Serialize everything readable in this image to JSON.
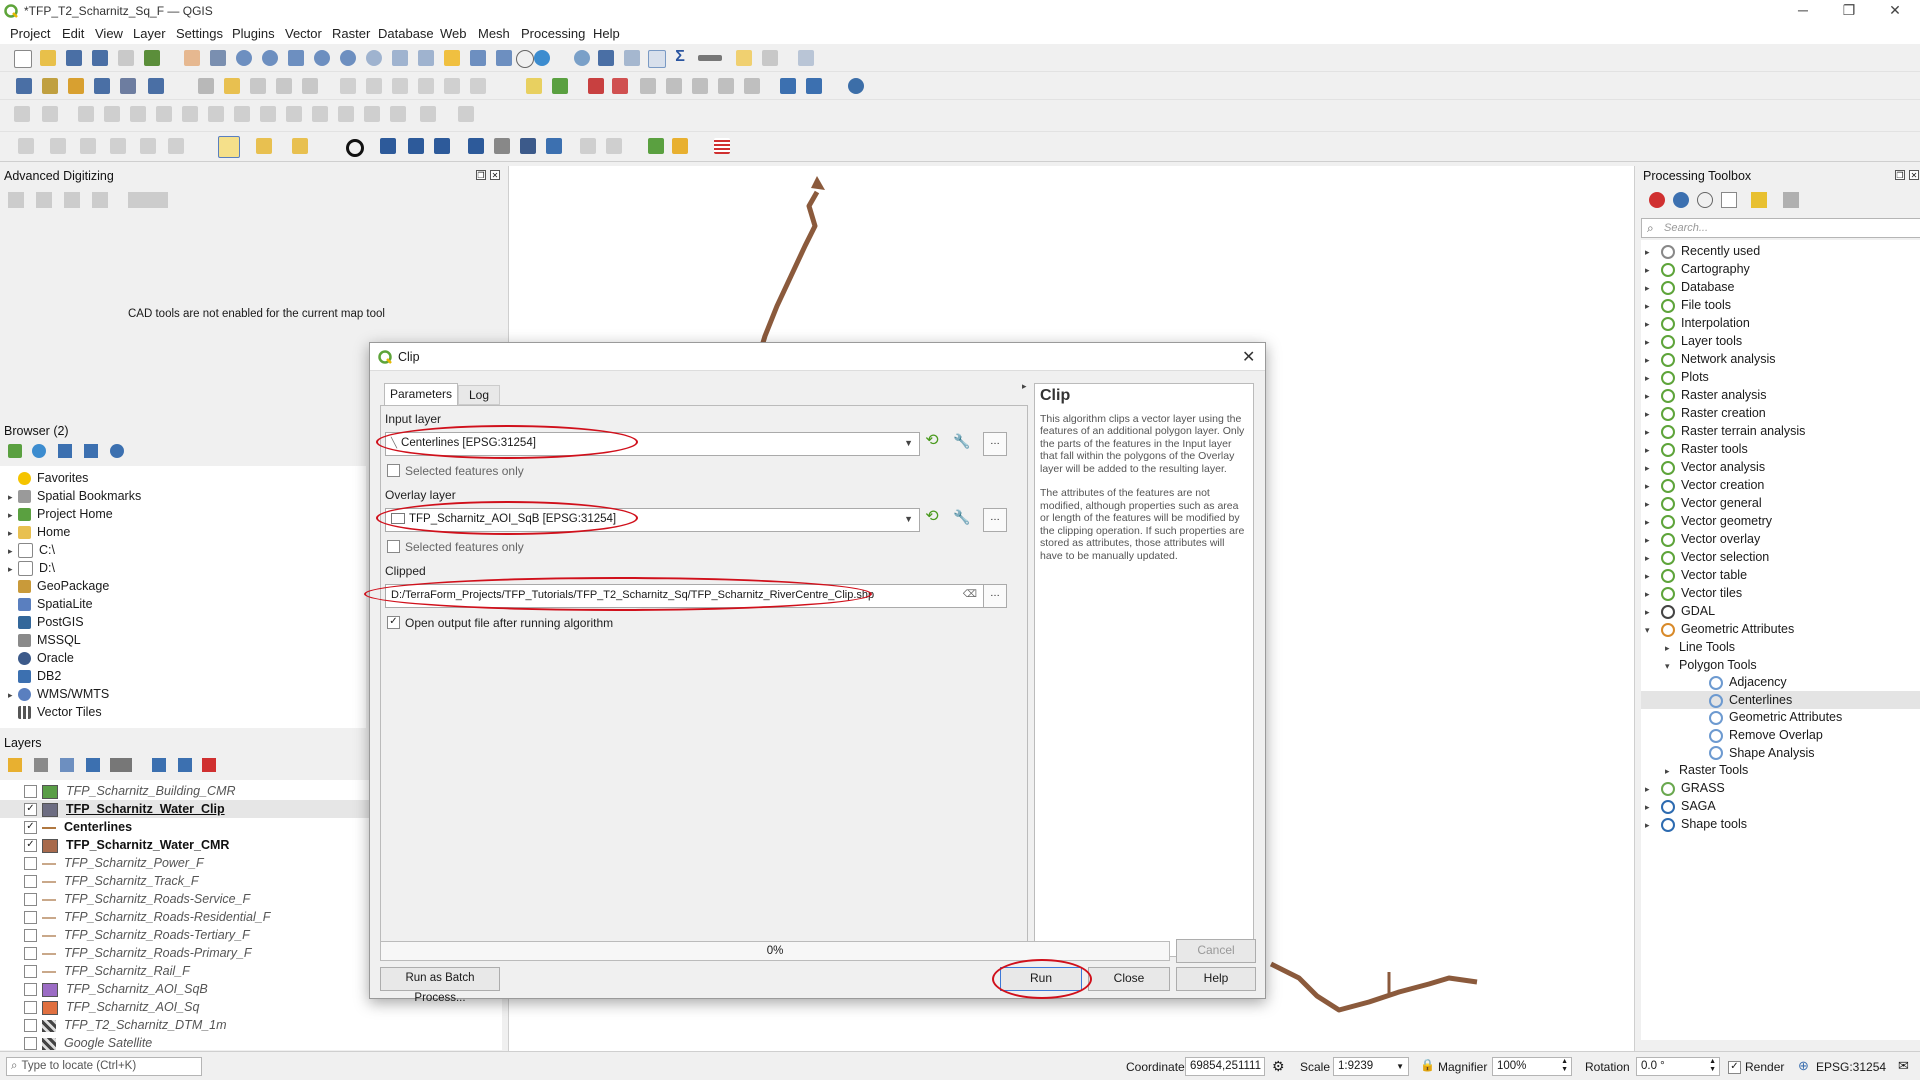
{
  "window": {
    "title": "*TFP_T2_Scharnitz_Sq_F — QGIS"
  },
  "menu": [
    "Project",
    "Edit",
    "View",
    "Layer",
    "Settings",
    "Plugins",
    "Vector",
    "Raster",
    "Database",
    "Web",
    "Mesh",
    "Processing",
    "Help"
  ],
  "adv_digitizing": {
    "title": "Advanced Digitizing",
    "message": "CAD tools are not enabled for the current map tool"
  },
  "browser": {
    "title": "Browser (2)",
    "items": [
      {
        "label": "Favorites",
        "icon": "star-icon",
        "expandable": false
      },
      {
        "label": "Spatial Bookmarks",
        "icon": "bookmark-icon",
        "expandable": true
      },
      {
        "label": "Project Home",
        "icon": "folder-icon",
        "expandable": true
      },
      {
        "label": "Home",
        "icon": "folder-icon",
        "expandable": true
      },
      {
        "label": "C:\\",
        "icon": "drive-icon",
        "expandable": true
      },
      {
        "label": "D:\\",
        "icon": "drive-icon",
        "expandable": true
      },
      {
        "label": "GeoPackage",
        "icon": "geopackage-icon",
        "expandable": false
      },
      {
        "label": "SpatiaLite",
        "icon": "spatialite-icon",
        "expandable": false
      },
      {
        "label": "PostGIS",
        "icon": "postgis-icon",
        "expandable": false
      },
      {
        "label": "MSSQL",
        "icon": "mssql-icon",
        "expandable": false
      },
      {
        "label": "Oracle",
        "icon": "oracle-icon",
        "expandable": false
      },
      {
        "label": "DB2",
        "icon": "db2-icon",
        "expandable": false
      },
      {
        "label": "WMS/WMTS",
        "icon": "globe-icon",
        "expandable": true
      },
      {
        "label": "Vector Tiles",
        "icon": "grid-icon",
        "expandable": false
      }
    ]
  },
  "layers": {
    "title": "Layers",
    "items": [
      {
        "label": "TFP_Scharnitz_Building_CMR",
        "checked": false,
        "swatch": "#5a9e47",
        "kind": "fill"
      },
      {
        "label": "TFP_Scharnitz_Water_Clip",
        "checked": true,
        "swatch": "#6d6d82",
        "kind": "fill",
        "underline": true
      },
      {
        "label": "Centerlines",
        "checked": true,
        "swatch": "#b07840",
        "kind": "line"
      },
      {
        "label": "TFP_Scharnitz_Water_CMR",
        "checked": true,
        "swatch": "#a86a4c",
        "kind": "fill"
      },
      {
        "label": "TFP_Scharnitz_Power_F",
        "checked": false,
        "swatch": "#c9a88a",
        "kind": "line"
      },
      {
        "label": "TFP_Scharnitz_Track_F",
        "checked": false,
        "swatch": "#c9a88a",
        "kind": "line"
      },
      {
        "label": "TFP_Scharnitz_Roads-Service_F",
        "checked": false,
        "swatch": "#c9a88a",
        "kind": "line"
      },
      {
        "label": "TFP_Scharnitz_Roads-Residential_F",
        "checked": false,
        "swatch": "#c9a88a",
        "kind": "line"
      },
      {
        "label": "TFP_Scharnitz_Roads-Tertiary_F",
        "checked": false,
        "swatch": "#c9a88a",
        "kind": "line"
      },
      {
        "label": "TFP_Scharnitz_Roads-Primary_F",
        "checked": false,
        "swatch": "#c9a88a",
        "kind": "line"
      },
      {
        "label": "TFP_Scharnitz_Rail_F",
        "checked": false,
        "swatch": "#c9a88a",
        "kind": "line"
      },
      {
        "label": "TFP_Scharnitz_AOI_SqB",
        "checked": false,
        "swatch": "#9b6cc4",
        "kind": "fill"
      },
      {
        "label": "TFP_Scharnitz_AOI_Sq",
        "checked": false,
        "swatch": "#e07040",
        "kind": "fill"
      },
      {
        "label": "TFP_T2_Scharnitz_DTM_1m",
        "checked": false,
        "swatch": "#888888",
        "kind": "raster"
      },
      {
        "label": "Google Satellite",
        "checked": false,
        "swatch": "#888888",
        "kind": "raster"
      }
    ]
  },
  "dialog": {
    "title": "Clip",
    "tabs": [
      "Parameters",
      "Log"
    ],
    "input_label": "Input layer",
    "input_value": "Centerlines [EPSG:31254]",
    "selected_only": "Selected features only",
    "overlay_label": "Overlay layer",
    "overlay_value": "TFP_Scharnitz_AOI_SqB [EPSG:31254]",
    "clipped_label": "Clipped",
    "clipped_value": "D:/TerraForm_Projects/TFP_Tutorials/TFP_T2_Scharnitz_Sq/TFP_Scharnitz_RiverCentre_Clip.shp",
    "open_output": "Open output file after running algorithm",
    "progress": "0%",
    "buttons": {
      "cancel": "Cancel",
      "batch": "Run as Batch Process...",
      "run": "Run",
      "close": "Close",
      "help": "Help"
    },
    "help_title": "Clip",
    "help_p1": "This algorithm clips a vector layer using the features of an additional polygon layer. Only the parts of the features in the Input layer that fall within the polygons of the Overlay layer will be added to the resulting layer.",
    "help_p2": "The attributes of the features are not modified, although properties such as area or length of the features will be modified by the clipping operation. If such properties are stored as attributes, those attributes will have to be manually updated."
  },
  "toolbox": {
    "title": "Processing Toolbox",
    "search_placeholder": "Search...",
    "items": [
      {
        "label": "Recently used",
        "level": 0,
        "arrow": "▸",
        "icon": "clock-icon"
      },
      {
        "label": "Cartography",
        "level": 0,
        "arrow": "▸",
        "icon": "qgis-icon"
      },
      {
        "label": "Database",
        "level": 0,
        "arrow": "▸",
        "icon": "qgis-icon"
      },
      {
        "label": "File tools",
        "level": 0,
        "arrow": "▸",
        "icon": "qgis-icon"
      },
      {
        "label": "Interpolation",
        "level": 0,
        "arrow": "▸",
        "icon": "qgis-icon"
      },
      {
        "label": "Layer tools",
        "level": 0,
        "arrow": "▸",
        "icon": "qgis-icon"
      },
      {
        "label": "Network analysis",
        "level": 0,
        "arrow": "▸",
        "icon": "qgis-icon"
      },
      {
        "label": "Plots",
        "level": 0,
        "arrow": "▸",
        "icon": "qgis-icon"
      },
      {
        "label": "Raster analysis",
        "level": 0,
        "arrow": "▸",
        "icon": "qgis-icon"
      },
      {
        "label": "Raster creation",
        "level": 0,
        "arrow": "▸",
        "icon": "qgis-icon"
      },
      {
        "label": "Raster terrain analysis",
        "level": 0,
        "arrow": "▸",
        "icon": "qgis-icon"
      },
      {
        "label": "Raster tools",
        "level": 0,
        "arrow": "▸",
        "icon": "qgis-icon"
      },
      {
        "label": "Vector analysis",
        "level": 0,
        "arrow": "▸",
        "icon": "qgis-icon"
      },
      {
        "label": "Vector creation",
        "level": 0,
        "arrow": "▸",
        "icon": "qgis-icon"
      },
      {
        "label": "Vector general",
        "level": 0,
        "arrow": "▸",
        "icon": "qgis-icon"
      },
      {
        "label": "Vector geometry",
        "level": 0,
        "arrow": "▸",
        "icon": "qgis-icon"
      },
      {
        "label": "Vector overlay",
        "level": 0,
        "arrow": "▸",
        "icon": "qgis-icon"
      },
      {
        "label": "Vector selection",
        "level": 0,
        "arrow": "▸",
        "icon": "qgis-icon"
      },
      {
        "label": "Vector table",
        "level": 0,
        "arrow": "▸",
        "icon": "qgis-icon"
      },
      {
        "label": "Vector tiles",
        "level": 0,
        "arrow": "▸",
        "icon": "qgis-icon"
      },
      {
        "label": "GDAL",
        "level": 0,
        "arrow": "▸",
        "icon": "gdal-icon"
      },
      {
        "label": "Geometric Attributes",
        "level": 0,
        "arrow": "▾",
        "icon": "wave-icon"
      },
      {
        "label": "Line Tools",
        "level": 1,
        "arrow": "▸",
        "icon": ""
      },
      {
        "label": "Polygon Tools",
        "level": 1,
        "arrow": "▾",
        "icon": ""
      },
      {
        "label": "Adjacency",
        "level": 2,
        "arrow": "",
        "icon": "gear-icon"
      },
      {
        "label": "Centerlines",
        "level": 2,
        "arrow": "",
        "icon": "gear-icon",
        "selected": true
      },
      {
        "label": "Geometric Attributes",
        "level": 2,
        "arrow": "",
        "icon": "gear-icon"
      },
      {
        "label": "Remove Overlap",
        "level": 2,
        "arrow": "",
        "icon": "gear-icon"
      },
      {
        "label": "Shape Analysis",
        "level": 2,
        "arrow": "",
        "icon": "gear-icon"
      },
      {
        "label": "Raster Tools",
        "level": 1,
        "arrow": "▸",
        "icon": ""
      },
      {
        "label": "GRASS",
        "level": 0,
        "arrow": "▸",
        "icon": "grass-icon"
      },
      {
        "label": "SAGA",
        "level": 0,
        "arrow": "▸",
        "icon": "saga-icon"
      },
      {
        "label": "Shape tools",
        "level": 0,
        "arrow": "▸",
        "icon": "shape-icon"
      }
    ]
  },
  "statusbar": {
    "locate_placeholder": "Type to locate (Ctrl+K)",
    "coordinate_label": "Coordinate",
    "coordinate_value": "69854,251111",
    "scale_label": "Scale",
    "scale_value": "1:9239",
    "magnifier_label": "Magnifier",
    "magnifier_value": "100%",
    "rotation_label": "Rotation",
    "rotation_value": "0.0 °",
    "render_label": "Render",
    "crs": "EPSG:31254"
  },
  "colors": {
    "river": "#8b5a3c",
    "highlight": "#d0101b",
    "accent": "#4a9a1e"
  }
}
